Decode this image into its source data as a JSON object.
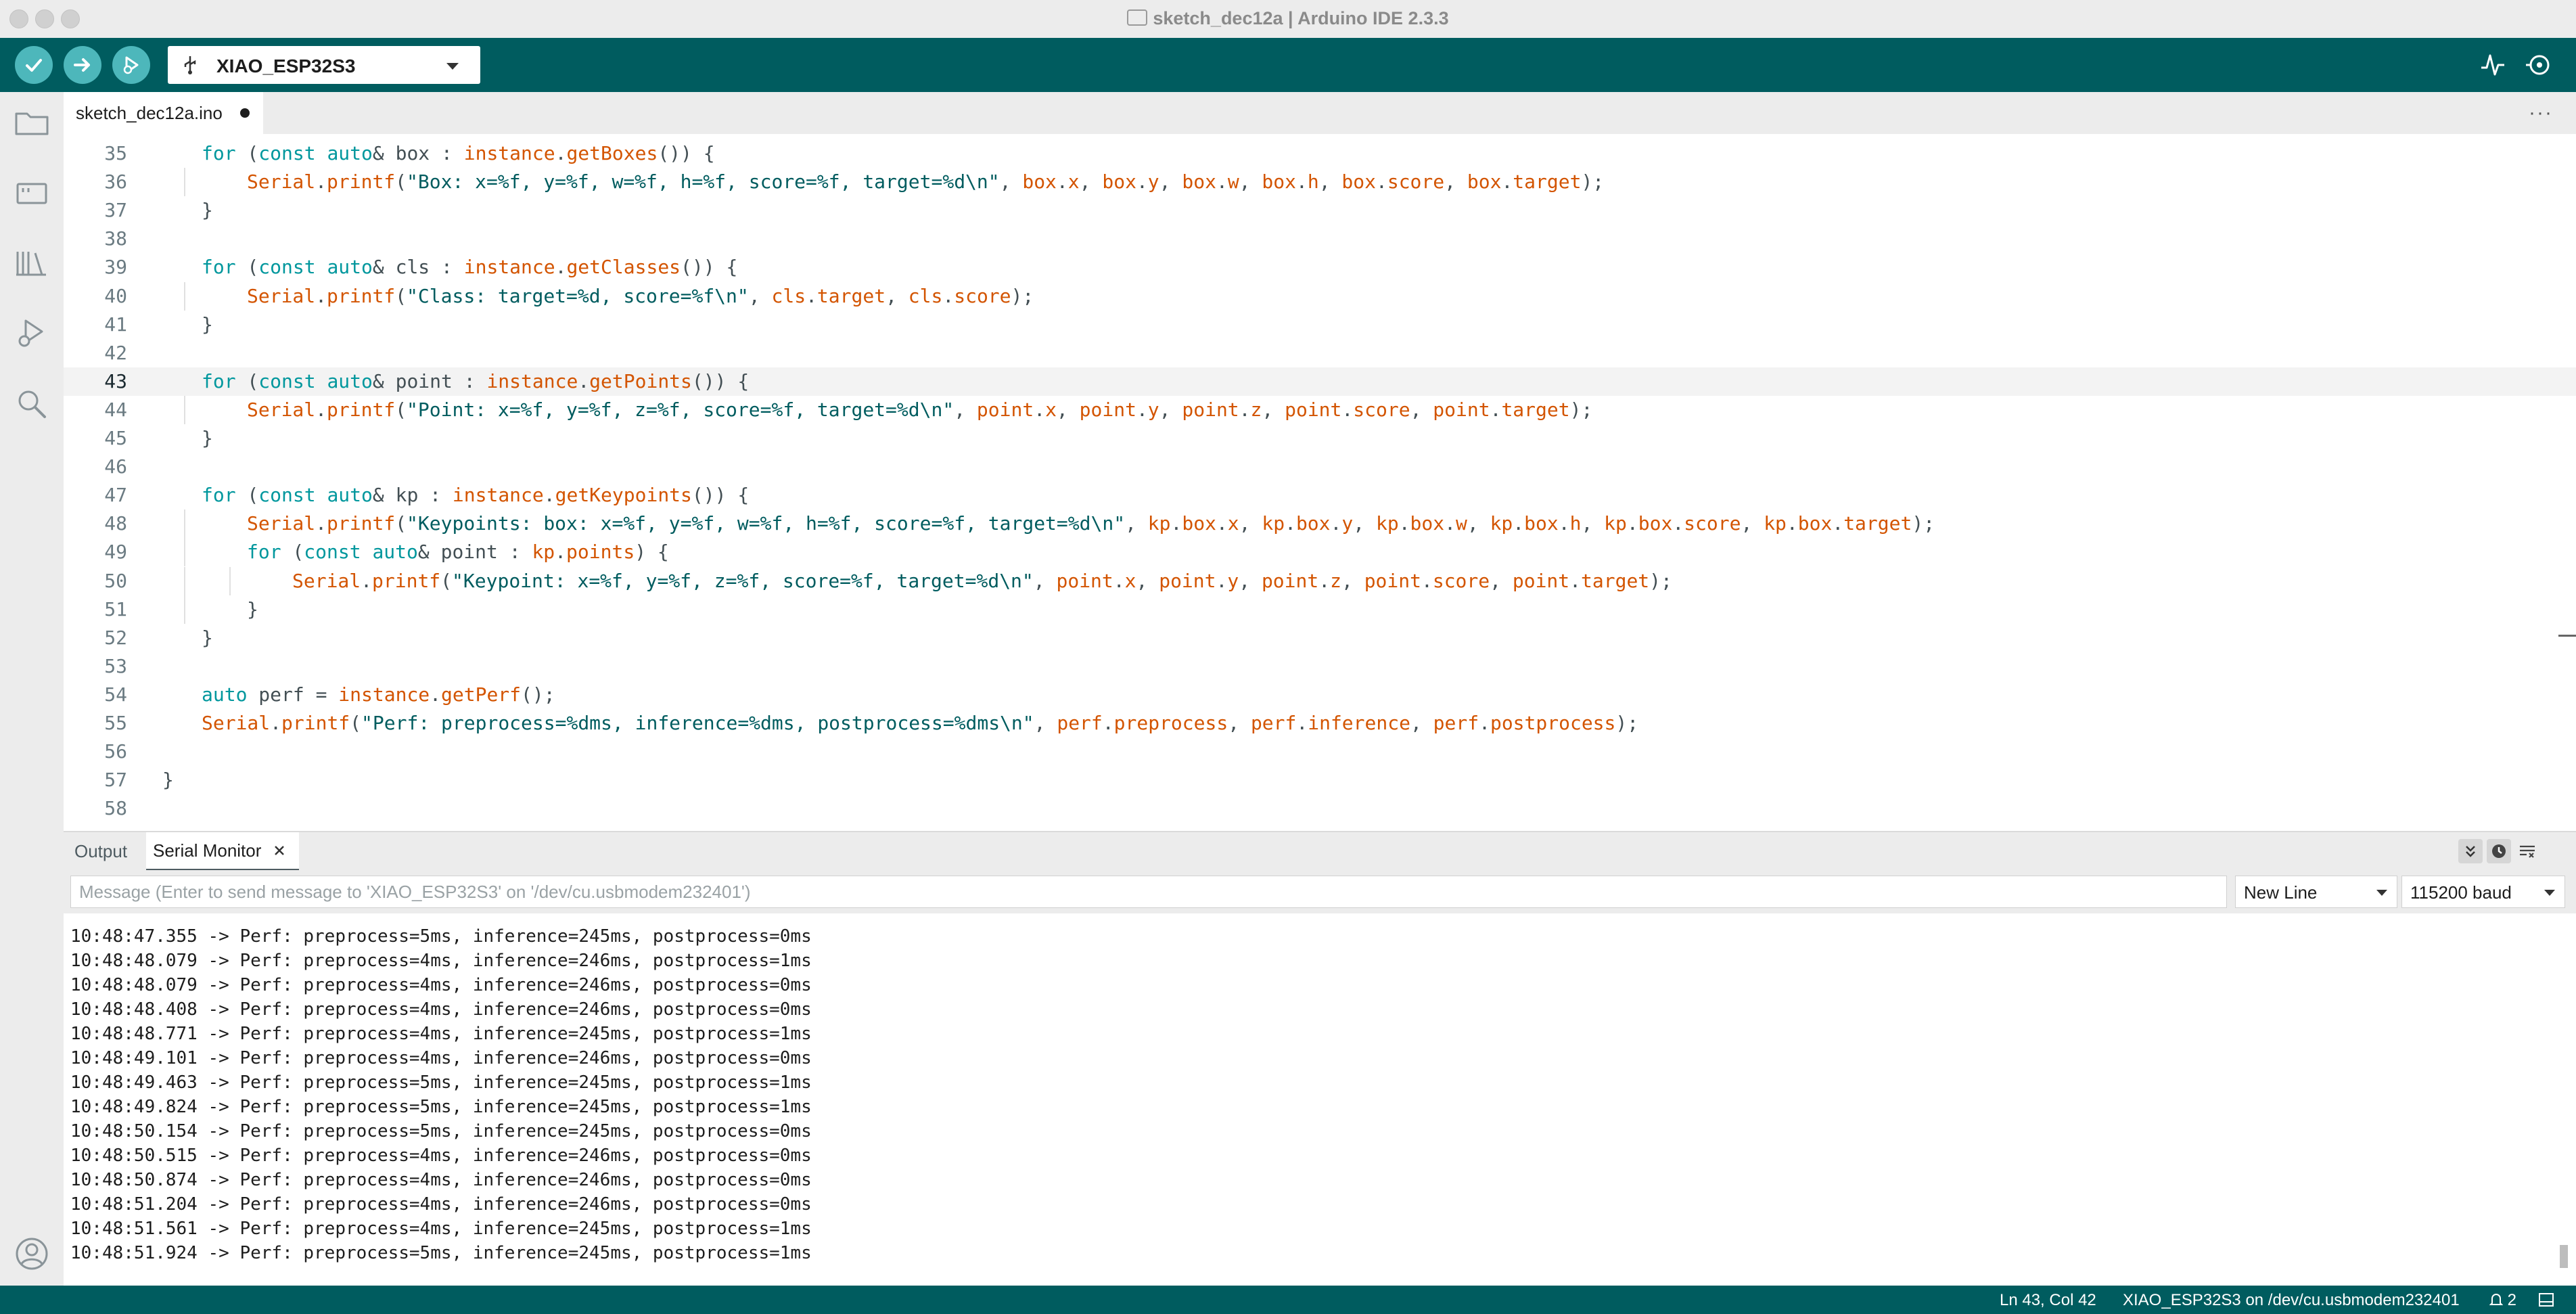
{
  "window": {
    "title": "sketch_dec12a | Arduino IDE 2.3.3"
  },
  "toolbar": {
    "verify_icon": "checkmark-icon",
    "upload_icon": "arrow-right-icon",
    "debug_icon": "debug-play-icon",
    "board": "XIAO_ESP32S3",
    "serial_plotter_icon": "pulse-icon",
    "serial_monitor_icon": "magnifier-icon"
  },
  "sidebar": {
    "items": [
      "folder-icon",
      "board-icon",
      "library-icon",
      "debug-icon",
      "search-icon"
    ],
    "account_icon": "account-icon"
  },
  "editor": {
    "tab_label": "sketch_dec12a.ino",
    "tab_modified": true,
    "current_line": 43,
    "lines": [
      {
        "n": "35",
        "indent": 1,
        "tokens": [
          [
            "kw",
            "for"
          ],
          [
            "p",
            " ("
          ],
          [
            "kw",
            "const auto"
          ],
          [
            "p",
            "& box : "
          ],
          [
            "fn",
            "instance"
          ],
          [
            "p",
            "."
          ],
          [
            "fn",
            "getBoxes"
          ],
          [
            "p",
            "()) {"
          ]
        ]
      },
      {
        "n": "36",
        "indent": 2,
        "tokens": [
          [
            "fn",
            "Serial"
          ],
          [
            "p",
            "."
          ],
          [
            "fn",
            "printf"
          ],
          [
            "p",
            "("
          ],
          [
            "str",
            "\"Box: x=%f, y=%f, w=%f, h=%f, score=%f, target=%d\\n\""
          ],
          [
            "p",
            ", "
          ],
          [
            "fn",
            "box"
          ],
          [
            "p",
            "."
          ],
          [
            "fn",
            "x"
          ],
          [
            "p",
            ", "
          ],
          [
            "fn",
            "box"
          ],
          [
            "p",
            "."
          ],
          [
            "fn",
            "y"
          ],
          [
            "p",
            ", "
          ],
          [
            "fn",
            "box"
          ],
          [
            "p",
            "."
          ],
          [
            "fn",
            "w"
          ],
          [
            "p",
            ", "
          ],
          [
            "fn",
            "box"
          ],
          [
            "p",
            "."
          ],
          [
            "fn",
            "h"
          ],
          [
            "p",
            ", "
          ],
          [
            "fn",
            "box"
          ],
          [
            "p",
            "."
          ],
          [
            "fn",
            "score"
          ],
          [
            "p",
            ", "
          ],
          [
            "fn",
            "box"
          ],
          [
            "p",
            "."
          ],
          [
            "fn",
            "target"
          ],
          [
            "p",
            ");"
          ]
        ]
      },
      {
        "n": "37",
        "indent": 1,
        "tokens": [
          [
            "p",
            "}"
          ]
        ]
      },
      {
        "n": "38",
        "indent": 1,
        "tokens": []
      },
      {
        "n": "39",
        "indent": 1,
        "tokens": [
          [
            "kw",
            "for"
          ],
          [
            "p",
            " ("
          ],
          [
            "kw",
            "const auto"
          ],
          [
            "p",
            "& cls : "
          ],
          [
            "fn",
            "instance"
          ],
          [
            "p",
            "."
          ],
          [
            "fn",
            "getClasses"
          ],
          [
            "p",
            "()) {"
          ]
        ]
      },
      {
        "n": "40",
        "indent": 2,
        "tokens": [
          [
            "fn",
            "Serial"
          ],
          [
            "p",
            "."
          ],
          [
            "fn",
            "printf"
          ],
          [
            "p",
            "("
          ],
          [
            "str",
            "\"Class: target=%d, score=%f\\n\""
          ],
          [
            "p",
            ", "
          ],
          [
            "fn",
            "cls"
          ],
          [
            "p",
            "."
          ],
          [
            "fn",
            "target"
          ],
          [
            "p",
            ", "
          ],
          [
            "fn",
            "cls"
          ],
          [
            "p",
            "."
          ],
          [
            "fn",
            "score"
          ],
          [
            "p",
            ");"
          ]
        ]
      },
      {
        "n": "41",
        "indent": 1,
        "tokens": [
          [
            "p",
            "}"
          ]
        ]
      },
      {
        "n": "42",
        "indent": 1,
        "tokens": []
      },
      {
        "n": "43",
        "indent": 1,
        "tokens": [
          [
            "kw",
            "for"
          ],
          [
            "p",
            " ("
          ],
          [
            "kw",
            "const auto"
          ],
          [
            "p",
            "& point : "
          ],
          [
            "fn",
            "instance"
          ],
          [
            "p",
            "."
          ],
          [
            "fn",
            "getPoints"
          ],
          [
            "p",
            "()) {"
          ]
        ]
      },
      {
        "n": "44",
        "indent": 2,
        "tokens": [
          [
            "fn",
            "Serial"
          ],
          [
            "p",
            "."
          ],
          [
            "fn",
            "printf"
          ],
          [
            "p",
            "("
          ],
          [
            "str",
            "\"Point: x=%f, y=%f, z=%f, score=%f, target=%d\\n\""
          ],
          [
            "p",
            ", "
          ],
          [
            "fn",
            "point"
          ],
          [
            "p",
            "."
          ],
          [
            "fn",
            "x"
          ],
          [
            "p",
            ", "
          ],
          [
            "fn",
            "point"
          ],
          [
            "p",
            "."
          ],
          [
            "fn",
            "y"
          ],
          [
            "p",
            ", "
          ],
          [
            "fn",
            "point"
          ],
          [
            "p",
            "."
          ],
          [
            "fn",
            "z"
          ],
          [
            "p",
            ", "
          ],
          [
            "fn",
            "point"
          ],
          [
            "p",
            "."
          ],
          [
            "fn",
            "score"
          ],
          [
            "p",
            ", "
          ],
          [
            "fn",
            "point"
          ],
          [
            "p",
            "."
          ],
          [
            "fn",
            "target"
          ],
          [
            "p",
            ");"
          ]
        ]
      },
      {
        "n": "45",
        "indent": 1,
        "tokens": [
          [
            "p",
            "}"
          ]
        ]
      },
      {
        "n": "46",
        "indent": 1,
        "tokens": []
      },
      {
        "n": "47",
        "indent": 1,
        "tokens": [
          [
            "kw",
            "for"
          ],
          [
            "p",
            " ("
          ],
          [
            "kw",
            "const auto"
          ],
          [
            "p",
            "& kp : "
          ],
          [
            "fn",
            "instance"
          ],
          [
            "p",
            "."
          ],
          [
            "fn",
            "getKeypoints"
          ],
          [
            "p",
            "()) {"
          ]
        ]
      },
      {
        "n": "48",
        "indent": 2,
        "tokens": [
          [
            "fn",
            "Serial"
          ],
          [
            "p",
            "."
          ],
          [
            "fn",
            "printf"
          ],
          [
            "p",
            "("
          ],
          [
            "str",
            "\"Keypoints: box: x=%f, y=%f, w=%f, h=%f, score=%f, target=%d\\n\""
          ],
          [
            "p",
            ", "
          ],
          [
            "fn",
            "kp"
          ],
          [
            "p",
            "."
          ],
          [
            "fn",
            "box"
          ],
          [
            "p",
            "."
          ],
          [
            "fn",
            "x"
          ],
          [
            "p",
            ", "
          ],
          [
            "fn",
            "kp"
          ],
          [
            "p",
            "."
          ],
          [
            "fn",
            "box"
          ],
          [
            "p",
            "."
          ],
          [
            "fn",
            "y"
          ],
          [
            "p",
            ", "
          ],
          [
            "fn",
            "kp"
          ],
          [
            "p",
            "."
          ],
          [
            "fn",
            "box"
          ],
          [
            "p",
            "."
          ],
          [
            "fn",
            "w"
          ],
          [
            "p",
            ", "
          ],
          [
            "fn",
            "kp"
          ],
          [
            "p",
            "."
          ],
          [
            "fn",
            "box"
          ],
          [
            "p",
            "."
          ],
          [
            "fn",
            "h"
          ],
          [
            "p",
            ", "
          ],
          [
            "fn",
            "kp"
          ],
          [
            "p",
            "."
          ],
          [
            "fn",
            "box"
          ],
          [
            "p",
            "."
          ],
          [
            "fn",
            "score"
          ],
          [
            "p",
            ", "
          ],
          [
            "fn",
            "kp"
          ],
          [
            "p",
            "."
          ],
          [
            "fn",
            "box"
          ],
          [
            "p",
            "."
          ],
          [
            "fn",
            "target"
          ],
          [
            "p",
            ");"
          ]
        ]
      },
      {
        "n": "49",
        "indent": 2,
        "tokens": [
          [
            "kw",
            "for"
          ],
          [
            "p",
            " ("
          ],
          [
            "kw",
            "const auto"
          ],
          [
            "p",
            "& point : "
          ],
          [
            "fn",
            "kp"
          ],
          [
            "p",
            "."
          ],
          [
            "fn",
            "points"
          ],
          [
            "p",
            ") {"
          ]
        ]
      },
      {
        "n": "50",
        "indent": 3,
        "tokens": [
          [
            "fn",
            "Serial"
          ],
          [
            "p",
            "."
          ],
          [
            "fn",
            "printf"
          ],
          [
            "p",
            "("
          ],
          [
            "str",
            "\"Keypoint: x=%f, y=%f, z=%f, score=%f, target=%d\\n\""
          ],
          [
            "p",
            ", "
          ],
          [
            "fn",
            "point"
          ],
          [
            "p",
            "."
          ],
          [
            "fn",
            "x"
          ],
          [
            "p",
            ", "
          ],
          [
            "fn",
            "point"
          ],
          [
            "p",
            "."
          ],
          [
            "fn",
            "y"
          ],
          [
            "p",
            ", "
          ],
          [
            "fn",
            "point"
          ],
          [
            "p",
            "."
          ],
          [
            "fn",
            "z"
          ],
          [
            "p",
            ", "
          ],
          [
            "fn",
            "point"
          ],
          [
            "p",
            "."
          ],
          [
            "fn",
            "score"
          ],
          [
            "p",
            ", "
          ],
          [
            "fn",
            "point"
          ],
          [
            "p",
            "."
          ],
          [
            "fn",
            "target"
          ],
          [
            "p",
            ");"
          ]
        ]
      },
      {
        "n": "51",
        "indent": 2,
        "tokens": [
          [
            "p",
            "}"
          ]
        ]
      },
      {
        "n": "52",
        "indent": 1,
        "tokens": [
          [
            "p",
            "}"
          ]
        ]
      },
      {
        "n": "53",
        "indent": 1,
        "tokens": []
      },
      {
        "n": "54",
        "indent": 1,
        "tokens": [
          [
            "kw",
            "auto"
          ],
          [
            "p",
            " perf = "
          ],
          [
            "fn",
            "instance"
          ],
          [
            "p",
            "."
          ],
          [
            "fn",
            "getPerf"
          ],
          [
            "p",
            "();"
          ]
        ]
      },
      {
        "n": "55",
        "indent": 1,
        "tokens": [
          [
            "fn",
            "Serial"
          ],
          [
            "p",
            "."
          ],
          [
            "fn",
            "printf"
          ],
          [
            "p",
            "("
          ],
          [
            "str",
            "\"Perf: preprocess=%dms, inference=%dms, postprocess=%dms\\n\""
          ],
          [
            "p",
            ", "
          ],
          [
            "fn",
            "perf"
          ],
          [
            "p",
            "."
          ],
          [
            "fn",
            "preprocess"
          ],
          [
            "p",
            ", "
          ],
          [
            "fn",
            "perf"
          ],
          [
            "p",
            "."
          ],
          [
            "fn",
            "inference"
          ],
          [
            "p",
            ", "
          ],
          [
            "fn",
            "perf"
          ],
          [
            "p",
            "."
          ],
          [
            "fn",
            "postprocess"
          ],
          [
            "p",
            ");"
          ]
        ]
      },
      {
        "n": "56",
        "indent": 1,
        "tokens": []
      },
      {
        "n": "57",
        "indent": 0,
        "tokens": [
          [
            "p",
            "}"
          ]
        ]
      },
      {
        "n": "58",
        "indent": 0,
        "tokens": []
      }
    ]
  },
  "panel": {
    "tabs": [
      "Output",
      "Serial Monitor"
    ],
    "close_icon": "close-icon",
    "autoscroll_icon": "double-chevron-down-icon",
    "timestamp_icon": "clock-icon",
    "clear_icon": "clear-list-icon",
    "message_placeholder": "Message (Enter to send message to 'XIAO_ESP32S3' on '/dev/cu.usbmodem232401')",
    "line_ending": "New Line",
    "baud": "115200 baud",
    "serial_lines": [
      "10:48:47.355 -> Perf: preprocess=5ms, inference=245ms, postprocess=0ms",
      "10:48:48.079 -> Perf: preprocess=4ms, inference=246ms, postprocess=1ms",
      "10:48:48.079 -> Perf: preprocess=4ms, inference=246ms, postprocess=0ms",
      "10:48:48.408 -> Perf: preprocess=4ms, inference=246ms, postprocess=0ms",
      "10:48:48.771 -> Perf: preprocess=4ms, inference=245ms, postprocess=1ms",
      "10:48:49.101 -> Perf: preprocess=4ms, inference=246ms, postprocess=0ms",
      "10:48:49.463 -> Perf: preprocess=5ms, inference=245ms, postprocess=1ms",
      "10:48:49.824 -> Perf: preprocess=5ms, inference=245ms, postprocess=1ms",
      "10:48:50.154 -> Perf: preprocess=5ms, inference=245ms, postprocess=0ms",
      "10:48:50.515 -> Perf: preprocess=4ms, inference=246ms, postprocess=0ms",
      "10:48:50.874 -> Perf: preprocess=4ms, inference=246ms, postprocess=0ms",
      "10:48:51.204 -> Perf: preprocess=4ms, inference=246ms, postprocess=0ms",
      "10:48:51.561 -> Perf: preprocess=4ms, inference=245ms, postprocess=1ms",
      "10:48:51.924 -> Perf: preprocess=5ms, inference=245ms, postprocess=1ms"
    ]
  },
  "statusbar": {
    "cursor": "Ln 43, Col 42",
    "board_port": "XIAO_ESP32S3 on /dev/cu.usbmodem232401",
    "notifications": "2",
    "notification_icon": "bell-icon",
    "layout_icon": "panel-layout-icon"
  },
  "colors": {
    "teal": "#005c5f",
    "teal_button": "#4db7bb",
    "keyword": "#00979d",
    "function": "#d35400",
    "string": "#005c5f"
  }
}
